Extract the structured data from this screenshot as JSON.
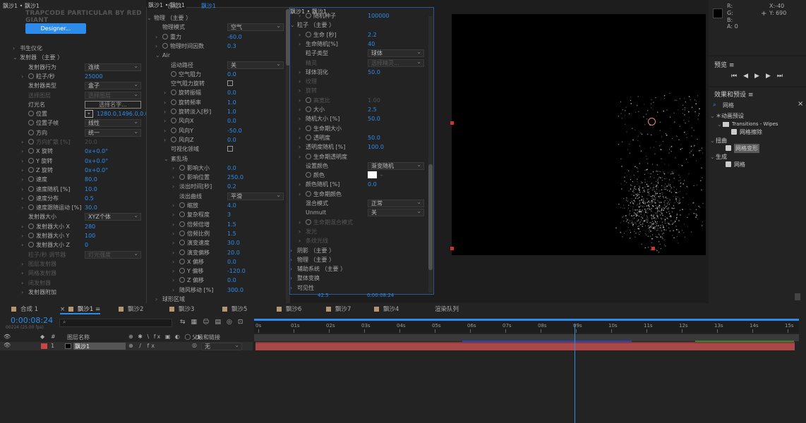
{
  "effects": {
    "title": "飘沙1 • 飘沙1",
    "logo": "TRAPCODE PARTICULAR BY RED GIANT",
    "designer": "Designer...",
    "rows": [
      {
        "i": 0,
        "tw": "›",
        "l": "书生仪化",
        "v": "",
        "t": "text"
      },
      {
        "i": 0,
        "tw": "⌄",
        "l": "发射器 （主要 ）",
        "v": "",
        "t": "text"
      },
      {
        "i": 1,
        "tw": "",
        "l": "发射器行为",
        "v": "连续",
        "t": "dd"
      },
      {
        "i": 1,
        "tw": "›",
        "sw": 1,
        "l": "粒子/秒",
        "v": "25000",
        "t": "num"
      },
      {
        "i": 1,
        "tw": "",
        "l": "发射器类型",
        "v": "盒子",
        "t": "dd"
      },
      {
        "i": 1,
        "tw": "",
        "l": "选择图层",
        "v": "选择图层",
        "t": "dim2"
      },
      {
        "i": 1,
        "tw": "",
        "l": "灯光名",
        "v": "选择名字...",
        "t": "btn"
      },
      {
        "i": 1,
        "tw": "",
        "sw": 1,
        "l": "位置",
        "v": "1280.0,1496.0,0.0",
        "t": "pos"
      },
      {
        "i": 1,
        "tw": "",
        "sw": 1,
        "l": "位置子帧",
        "v": "线性",
        "t": "dd"
      },
      {
        "i": 1,
        "tw": "",
        "sw": 1,
        "l": "方向",
        "v": "统一",
        "t": "dd"
      },
      {
        "i": 1,
        "tw": "›",
        "sw": 1,
        "l": "方向扩散 [%]",
        "v": "20.0",
        "t": "dimnum"
      },
      {
        "i": 1,
        "tw": "›",
        "sw": 1,
        "l": "X 旋转",
        "v": "0x+0.0°",
        "t": "num"
      },
      {
        "i": 1,
        "tw": "›",
        "sw": 1,
        "l": "Y 旋转",
        "v": "0x+0.0°",
        "t": "num"
      },
      {
        "i": 1,
        "tw": "›",
        "sw": 1,
        "l": "Z 旋转",
        "v": "0x+0.0°",
        "t": "num"
      },
      {
        "i": 1,
        "tw": "›",
        "sw": 1,
        "l": "速度",
        "v": "80.0",
        "t": "num"
      },
      {
        "i": 1,
        "tw": "›",
        "sw": 1,
        "l": "速度随机 [%]",
        "v": "10.0",
        "t": "num"
      },
      {
        "i": 1,
        "tw": "›",
        "sw": 1,
        "l": "速度分布",
        "v": "0.5",
        "t": "num"
      },
      {
        "i": 1,
        "tw": "›",
        "sw": 1,
        "l": "速度跟随运动 [%]",
        "v": "30.0",
        "t": "num"
      },
      {
        "i": 1,
        "tw": "",
        "l": "发射器大小",
        "v": "XYZ个体",
        "t": "dd"
      },
      {
        "i": 1,
        "tw": "›",
        "sw": 1,
        "l": "发射器大小 X",
        "v": "280",
        "t": "num"
      },
      {
        "i": 1,
        "tw": "›",
        "sw": 1,
        "l": "发射器大小 Y",
        "v": "100",
        "t": "num"
      },
      {
        "i": 1,
        "tw": "›",
        "sw": 1,
        "l": "发射器大小 Z",
        "v": "0",
        "t": "num"
      },
      {
        "i": 1,
        "tw": "",
        "l": "粒子/秒 调节器",
        "v": "灯光强度",
        "t": "dim2"
      },
      {
        "i": 1,
        "tw": "›",
        "l": "图层发射器",
        "v": "",
        "t": "dimtext"
      },
      {
        "i": 1,
        "tw": "›",
        "l": "网格发射器",
        "v": "",
        "t": "dimtext"
      },
      {
        "i": 1,
        "tw": "›",
        "l": "闭发射器",
        "v": "",
        "t": "dimtext"
      },
      {
        "i": 1,
        "tw": "›",
        "l": "发射器附加",
        "v": "",
        "t": "text"
      }
    ]
  },
  "physics": {
    "header": "飘沙1 • 飘沙1",
    "rows": [
      {
        "x": 10,
        "tw": "⌄",
        "l": "物理 （主要 ）",
        "v": "",
        "t": "text"
      },
      {
        "x": 22,
        "tw": "",
        "l": "物理模式",
        "v": "空气",
        "t": "dd"
      },
      {
        "x": 22,
        "tw": "›",
        "sw": 1,
        "l": "重力",
        "v": "-60.0",
        "t": "num"
      },
      {
        "x": 22,
        "tw": "›",
        "sw": 1,
        "l": "物理时间因数",
        "v": "0.3",
        "t": "num"
      },
      {
        "x": 22,
        "tw": "⌄",
        "l": "Air",
        "v": "",
        "t": "text"
      },
      {
        "x": 34,
        "tw": "",
        "l": "运动路径",
        "v": "关",
        "t": "dd"
      },
      {
        "x": 34,
        "tw": "",
        "sw": 1,
        "l": "空气阻力",
        "v": "0.0",
        "t": "num"
      },
      {
        "x": 34,
        "tw": "",
        "l": "空气阻力旋转",
        "v": "",
        "t": "cb"
      },
      {
        "x": 34,
        "tw": "›",
        "sw": 1,
        "l": "旋转振幅",
        "v": "0.0",
        "t": "num"
      },
      {
        "x": 34,
        "tw": "›",
        "sw": 1,
        "l": "旋转频率",
        "v": "1.0",
        "t": "num"
      },
      {
        "x": 34,
        "tw": "›",
        "sw": 1,
        "l": "旋转淡入[秒]",
        "v": "1.0",
        "t": "num"
      },
      {
        "x": 34,
        "tw": "›",
        "sw": 1,
        "l": "风向X",
        "v": "0.0",
        "t": "num"
      },
      {
        "x": 34,
        "tw": "›",
        "sw": 1,
        "l": "风向Y",
        "v": "-50.0",
        "t": "num"
      },
      {
        "x": 34,
        "tw": "›",
        "sw": 1,
        "l": "风向Z",
        "v": "0.0",
        "t": "num"
      },
      {
        "x": 34,
        "tw": "",
        "l": "可视化领域",
        "v": "",
        "t": "cb"
      },
      {
        "x": 34,
        "tw": "⌄",
        "l": "紊乱场",
        "v": "",
        "t": "text"
      },
      {
        "x": 46,
        "tw": "›",
        "sw": 1,
        "l": "影响大小",
        "v": "0.0",
        "t": "num"
      },
      {
        "x": 46,
        "tw": "›",
        "sw": 1,
        "l": "影响位置",
        "v": "250.0",
        "t": "num"
      },
      {
        "x": 46,
        "tw": "›",
        "l": "淡出时间[秒]",
        "v": "0.2",
        "t": "num"
      },
      {
        "x": 46,
        "tw": "",
        "l": "淡出曲线",
        "v": "平滑",
        "t": "dd"
      },
      {
        "x": 46,
        "tw": "›",
        "sw": 1,
        "l": "缩放",
        "v": "4.0",
        "t": "num"
      },
      {
        "x": 46,
        "tw": "›",
        "sw": 1,
        "l": "复杂程度",
        "v": "3",
        "t": "num"
      },
      {
        "x": 46,
        "tw": "›",
        "sw": 1,
        "l": "倍频倍增",
        "v": "1.5",
        "t": "num"
      },
      {
        "x": 46,
        "tw": "›",
        "sw": 1,
        "l": "倍频比例",
        "v": "1.5",
        "t": "num"
      },
      {
        "x": 46,
        "tw": "›",
        "sw": 1,
        "l": "演变速度",
        "v": "30.0",
        "t": "num"
      },
      {
        "x": 46,
        "tw": "›",
        "sw": 1,
        "l": "演变偏移",
        "v": "20.0",
        "t": "num"
      },
      {
        "x": 46,
        "tw": "›",
        "sw": 1,
        "l": "X 偏移",
        "v": "0.0",
        "t": "num"
      },
      {
        "x": 46,
        "tw": "›",
        "sw": 1,
        "l": "Y 偏移",
        "v": "-120.0",
        "t": "num"
      },
      {
        "x": 46,
        "tw": "›",
        "sw": 1,
        "l": "Z 偏移",
        "v": "0.0",
        "t": "num"
      },
      {
        "x": 46,
        "tw": "›",
        "l": "随风移动 [%]",
        "v": "300.0",
        "t": "num"
      },
      {
        "x": 22,
        "tw": "›",
        "l": "球形区域",
        "v": "",
        "t": "text"
      }
    ]
  },
  "particle": {
    "header": "飘沙1 • 飘沙1",
    "rows": [
      {
        "x": 22,
        "tw": "›",
        "sw": 1,
        "l": "随机种子",
        "v": "100000",
        "t": "num"
      },
      {
        "x": 10,
        "tw": "⌄",
        "l": "粒子 （主要 ）",
        "v": "",
        "t": "text"
      },
      {
        "x": 22,
        "tw": "›",
        "sw": 1,
        "l": "生命 [秒]",
        "v": "2.2",
        "t": "num"
      },
      {
        "x": 22,
        "tw": "›",
        "l": "生命随机[%]",
        "v": "40",
        "t": "num"
      },
      {
        "x": 22,
        "tw": "",
        "l": "粒子类型",
        "v": "球体",
        "t": "dd"
      },
      {
        "x": 22,
        "tw": "",
        "l": "精灵",
        "v": "选择精灵...",
        "t": "dim2"
      },
      {
        "x": 22,
        "tw": "›",
        "l": "球体羽化",
        "v": "50.0",
        "t": "num"
      },
      {
        "x": 22,
        "tw": "›",
        "l": "纹理",
        "v": "",
        "t": "dimtext"
      },
      {
        "x": 22,
        "tw": "›",
        "l": "旋转",
        "v": "",
        "t": "dimtext"
      },
      {
        "x": 22,
        "tw": "›",
        "sw": 1,
        "l": "高宽比",
        "v": "1.00",
        "t": "dimnum"
      },
      {
        "x": 22,
        "tw": "›",
        "sw": 1,
        "l": "大小",
        "v": "2.5",
        "t": "num"
      },
      {
        "x": 22,
        "tw": "›",
        "l": "随机大小 [%]",
        "v": "50.0",
        "t": "num"
      },
      {
        "x": 22,
        "tw": "›",
        "sw": 1,
        "l": "生命期大小",
        "v": "",
        "t": "text"
      },
      {
        "x": 22,
        "tw": "›",
        "sw": 1,
        "l": "透明度",
        "v": "50.0",
        "t": "num"
      },
      {
        "x": 22,
        "tw": "›",
        "l": "透明度随机 [%]",
        "v": "100.0",
        "t": "num"
      },
      {
        "x": 22,
        "tw": "›",
        "sw": 1,
        "l": "生命期透明度",
        "v": "",
        "t": "text"
      },
      {
        "x": 22,
        "tw": "",
        "l": "设置颜色",
        "v": "渐变随机",
        "t": "dd"
      },
      {
        "x": 22,
        "tw": "",
        "sw": 1,
        "l": "颜色",
        "v": "",
        "t": "color"
      },
      {
        "x": 22,
        "tw": "›",
        "l": "颜色随机 [%]",
        "v": "0.0",
        "t": "num"
      },
      {
        "x": 22,
        "tw": "›",
        "sw": 1,
        "l": "生命期颜色",
        "v": "",
        "t": "text"
      },
      {
        "x": 22,
        "tw": "",
        "l": "混合模式",
        "v": "正常",
        "t": "dd"
      },
      {
        "x": 22,
        "tw": "",
        "l": "Unmult",
        "v": "关",
        "t": "dd"
      },
      {
        "x": 22,
        "tw": "›",
        "sw": 1,
        "l": "生命期混合模式",
        "v": "",
        "t": "dimtext"
      },
      {
        "x": 22,
        "tw": "›",
        "l": "发光",
        "v": "",
        "t": "dimtext"
      },
      {
        "x": 22,
        "tw": "›",
        "l": "条纹光线",
        "v": "",
        "t": "dimtext"
      },
      {
        "x": 10,
        "tw": "›",
        "l": "阴影 （主要 ）",
        "v": "",
        "t": "text"
      },
      {
        "x": 10,
        "tw": "›",
        "l": "物理 （主要 ）",
        "v": "",
        "t": "text"
      },
      {
        "x": 10,
        "tw": "›",
        "l": "辅助系统 （主要 ）",
        "v": "",
        "t": "text"
      },
      {
        "x": 10,
        "tw": "›",
        "l": "整体变换",
        "v": "",
        "t": "text"
      },
      {
        "x": 10,
        "tw": "›",
        "l": "可见性",
        "v": "",
        "t": "text"
      }
    ]
  },
  "viewer_tab": "合成1",
  "comp_tab": "飘沙1",
  "info": {
    "r": "R:",
    "g": "G:",
    "b": "B:",
    "a": "A: 0",
    "x": "X:-40",
    "y": "Y: 690"
  },
  "preview": {
    "title": "预览"
  },
  "effects_presets": {
    "title": "效果和预设",
    "search": "网格",
    "tree": [
      {
        "x": 8,
        "tw": "⌄",
        "icon": "",
        "l": "＊动画预设"
      },
      {
        "x": 18,
        "tw": "⌄",
        "icon": "folder",
        "l": "Transitions - Wipes"
      },
      {
        "x": 30,
        "tw": "",
        "icon": "fx",
        "l": "网格擦除"
      },
      {
        "x": 8,
        "tw": "⌄",
        "icon": "",
        "l": "扭曲"
      },
      {
        "x": 22,
        "tw": "",
        "icon": "fx",
        "l": "网格变形",
        "sel": 1
      },
      {
        "x": 8,
        "tw": "⌄",
        "icon": "",
        "l": "生成"
      },
      {
        "x": 22,
        "tw": "",
        "icon": "fx",
        "l": "网格"
      }
    ]
  },
  "timeline": {
    "tabs": [
      {
        "l": "合成 1",
        "c": "#b49673"
      },
      {
        "l": "飘沙1",
        "c": "#b49673",
        "active": 1
      },
      {
        "l": "飘沙2",
        "c": "#b49673"
      },
      {
        "l": "飘沙3",
        "c": "#b49673"
      },
      {
        "l": "飘沙5",
        "c": "#b49673"
      },
      {
        "l": "飘沙6",
        "c": "#b49673"
      },
      {
        "l": "飘沙7",
        "c": "#b49673"
      },
      {
        "l": "飘沙4",
        "c": "#b49673"
      },
      {
        "l": "渲染队列",
        "c": ""
      }
    ],
    "timecode": "0:00:08:24",
    "fps": "00224 (25.00 fps)",
    "col_layer_name": "图层名称",
    "col_parent": "父级和链接",
    "layer": {
      "num": "1",
      "name": "飘沙1",
      "parent": "无"
    },
    "ruler": [
      "0s",
      "01s",
      "02s",
      "03s",
      "04s",
      "05s",
      "06s",
      "07s",
      "08s",
      "09s",
      "10s",
      "11s",
      "12s",
      "13s",
      "14s",
      "15s"
    ],
    "playhead_sec": 8.96
  },
  "status": {
    "timecode": "0:00:08:24",
    "zoom": "42.5"
  }
}
